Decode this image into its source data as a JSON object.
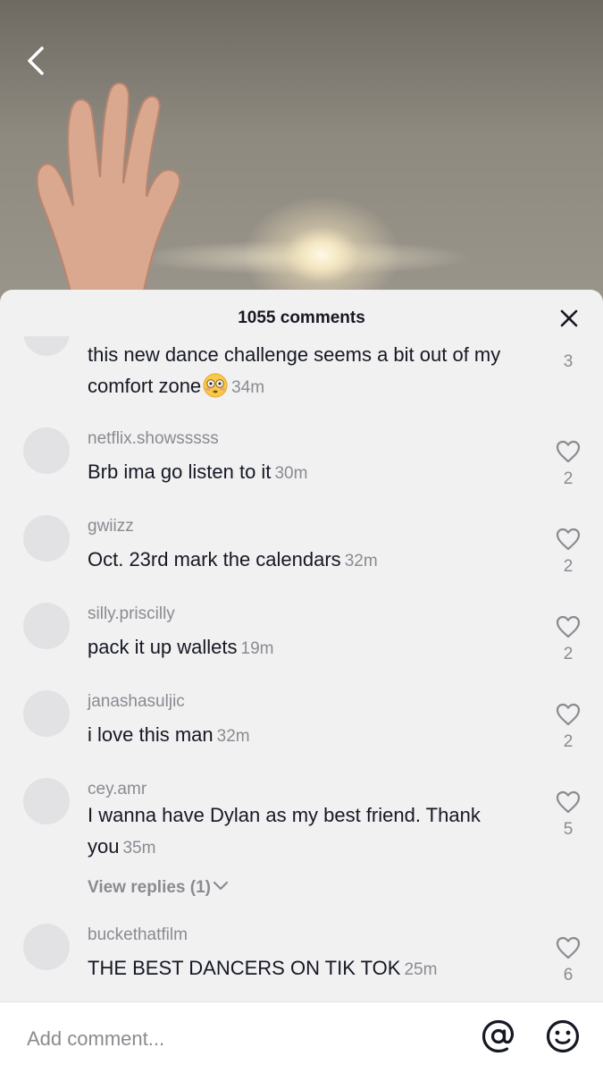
{
  "header": {
    "comment_count": "1055 comments"
  },
  "icons": {
    "back": "chevron-left-icon",
    "close": "close-icon",
    "like": "heart-outline-icon",
    "mention": "at-sign-icon",
    "emoji": "smiley-icon"
  },
  "comments": [
    {
      "username": "",
      "text": "this new dance challenge seems a bit out of my comfort zone",
      "emoji": "flushed-face",
      "time": "34m",
      "likes": "3"
    },
    {
      "username": "netflix.showsssss",
      "text": "Brb ima go listen to it",
      "time": "30m",
      "likes": "2"
    },
    {
      "username": "gwiizz",
      "text": "Oct. 23rd mark the calendars",
      "time": "32m",
      "likes": "2"
    },
    {
      "username": "silly.priscilly",
      "text": "pack it up wallets",
      "time": "19m",
      "likes": "2"
    },
    {
      "username": "janashasuljic",
      "text": "i love this man",
      "time": "32m",
      "likes": "2"
    },
    {
      "username": "cey.amr",
      "text": "I wanna have Dylan as my best friend. Thank you",
      "time": "35m",
      "likes": "5",
      "view_replies": "View replies (1)"
    },
    {
      "username": "buckethatfilm",
      "text": "THE BEST DANCERS ON TIK TOK",
      "time": "25m",
      "likes": "6"
    }
  ],
  "composer": {
    "placeholder": "Add comment..."
  }
}
